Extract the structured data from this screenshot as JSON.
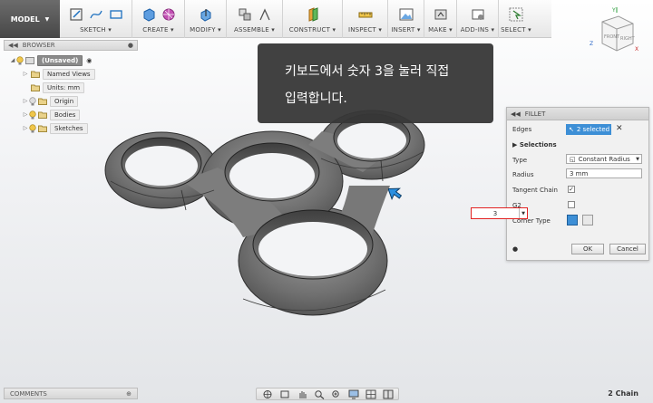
{
  "toolbar": {
    "mode": "MODEL",
    "groups": [
      {
        "label": "SKETCH ▾"
      },
      {
        "label": "CREATE ▾"
      },
      {
        "label": "MODIFY ▾"
      },
      {
        "label": "ASSEMBLE ▾"
      },
      {
        "label": "CONSTRUCT ▾"
      },
      {
        "label": "INSPECT ▾"
      },
      {
        "label": "INSERT ▾"
      },
      {
        "label": "MAKE ▾"
      },
      {
        "label": "ADD-INS ▾"
      },
      {
        "label": "SELECT ▾"
      }
    ]
  },
  "browser": {
    "title": "BROWSER",
    "items": [
      {
        "label": "(Unsaved)"
      },
      {
        "label": "Named Views"
      },
      {
        "label": "Units: mm"
      },
      {
        "label": "Origin"
      },
      {
        "label": "Bodies"
      },
      {
        "label": "Sketches"
      }
    ]
  },
  "tooltip": {
    "line1": "키보드에서 숫자 3을 눌러 직접",
    "line2": "입력합니다."
  },
  "fillet": {
    "title": "FILLET",
    "edges_label": "Edges",
    "edges_value": "2 selected",
    "selections_label": "Selections",
    "type_label": "Type",
    "type_value": "Constant Radius",
    "radius_label": "Radius",
    "radius_value": "3 mm",
    "tangent_chain_label": "Tangent Chain",
    "g2_label": "G2",
    "corner_type_label": "Corner Type",
    "ok_label": "OK",
    "cancel_label": "Cancel"
  },
  "value_input": {
    "value": "3"
  },
  "viewcube": {
    "front": "FRONT",
    "right": "RIGHT",
    "x": "X",
    "y": "Y",
    "z": "Z"
  },
  "comments": {
    "title": "COMMENTS"
  },
  "status": {
    "chain": "2 Chain"
  },
  "colors": {
    "accent": "#3d8fd6",
    "highlight_red": "#e32222",
    "model_body": "#7a7a7a"
  }
}
